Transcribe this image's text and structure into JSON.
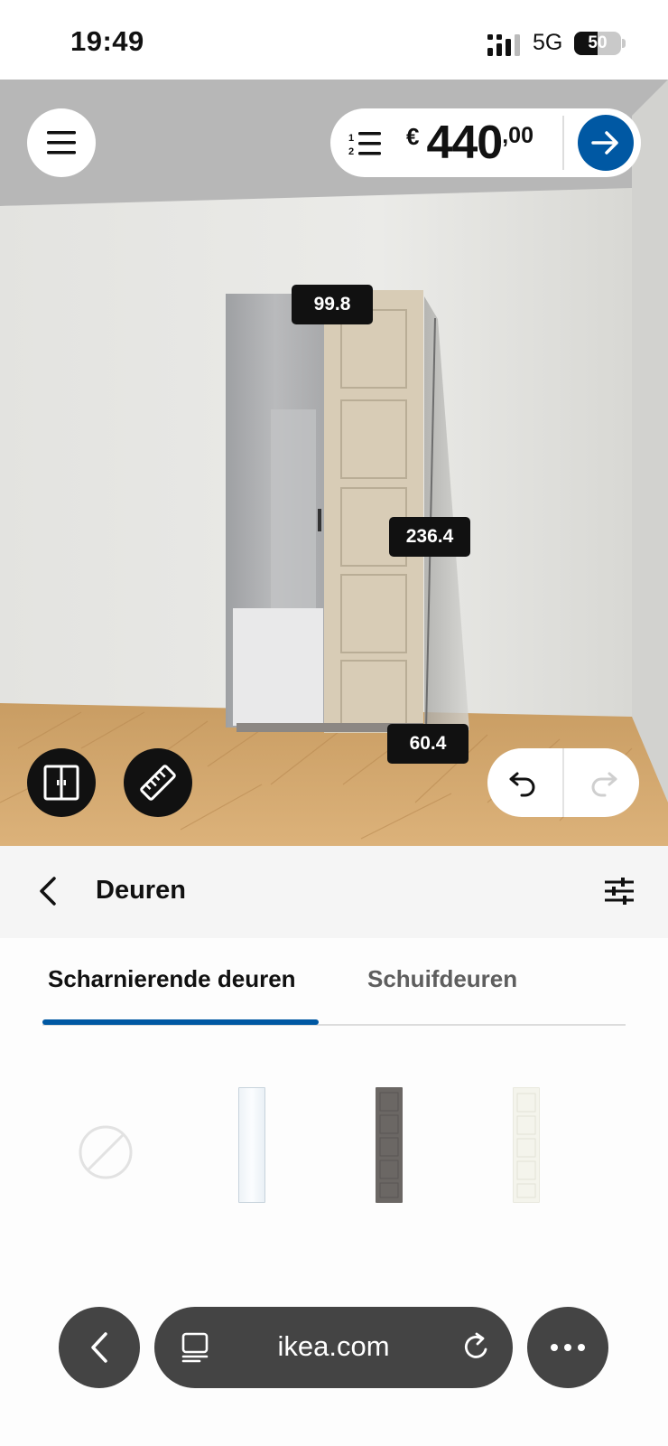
{
  "status_bar": {
    "time": "19:49",
    "network": "5G",
    "battery": "50"
  },
  "toolbar": {
    "currency": "€",
    "price_whole": "440",
    "price_cents": ",00"
  },
  "dimensions": {
    "width": "99.8",
    "height": "236.4",
    "depth": "60.4"
  },
  "panel": {
    "title": "Deuren"
  },
  "tabs": [
    {
      "label": "Scharnierende deuren",
      "active": true
    },
    {
      "label": "Schuifdeuren",
      "active": false
    }
  ],
  "door_options": [
    {
      "name": "none",
      "color": "#e2e2e2"
    },
    {
      "name": "mirror",
      "color": "#f4f8fb"
    },
    {
      "name": "dark-gray-panel",
      "color": "#6b6764"
    },
    {
      "name": "white-panel",
      "color": "#f4f4ec"
    }
  ],
  "browser": {
    "url": "ikea.com"
  },
  "colors": {
    "accent": "#0058a3",
    "dark": "#111111",
    "browser_chrome": "#444444"
  }
}
